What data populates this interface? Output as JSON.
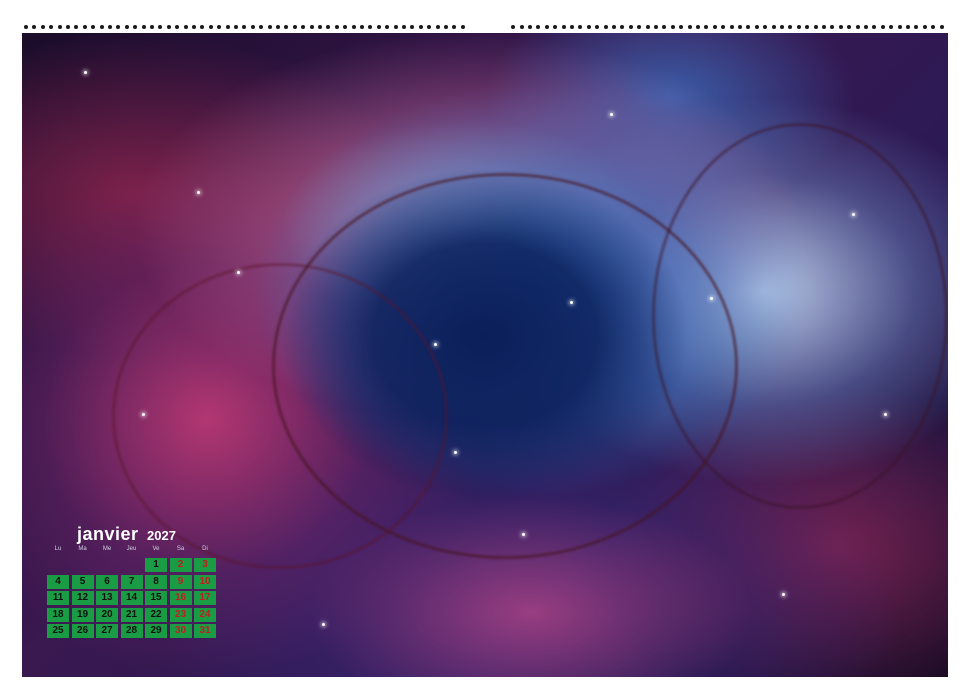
{
  "calendar": {
    "month": "janvier",
    "year": "2027",
    "weekdays": [
      "Lu",
      "Ma",
      "Me",
      "Jeu",
      "Ve",
      "Sa",
      "Di"
    ],
    "weeks": [
      [
        "",
        "",
        "",
        "",
        "1",
        "2",
        "3"
      ],
      [
        "4",
        "5",
        "6",
        "7",
        "8",
        "9",
        "10"
      ],
      [
        "11",
        "12",
        "13",
        "14",
        "15",
        "16",
        "17"
      ],
      [
        "18",
        "19",
        "20",
        "21",
        "22",
        "23",
        "24"
      ],
      [
        "25",
        "26",
        "27",
        "28",
        "29",
        "30",
        "31"
      ]
    ]
  },
  "photo": {
    "subject": "nebula-image"
  },
  "colors": {
    "day_cell": "#1a9c45",
    "weekday_text": "#111111",
    "weekend_text": "#c21d1d"
  }
}
